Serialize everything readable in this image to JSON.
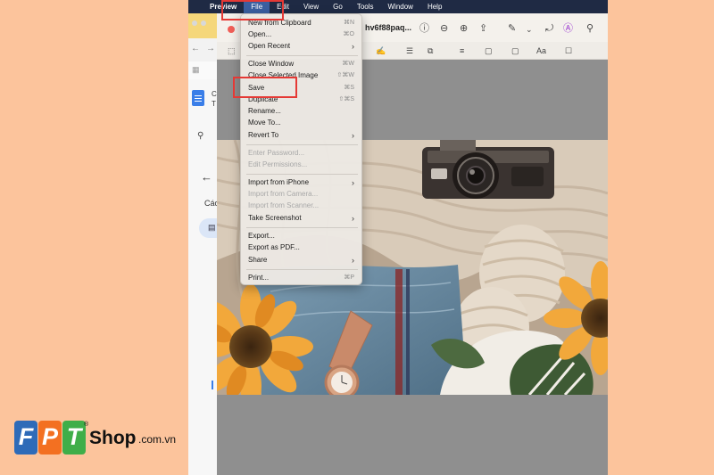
{
  "menubar": {
    "app_name": "Preview",
    "items": [
      "File",
      "Edit",
      "View",
      "Go",
      "Tools",
      "Window",
      "Help"
    ]
  },
  "background_window": {
    "doc_title_short": "C",
    "doc_title_line2": "T",
    "section_text": "Các"
  },
  "preview": {
    "filename": "hv6f88paq..."
  },
  "file_menu": {
    "items": [
      {
        "label": "New from Clipboard",
        "shortcut": "⌘N",
        "enabled": true
      },
      {
        "label": "Open...",
        "shortcut": "⌘O",
        "enabled": true
      },
      {
        "label": "Open Recent",
        "submenu": true,
        "enabled": true
      },
      {
        "label": "Close Window",
        "shortcut": "⌘W",
        "enabled": true
      },
      {
        "label": "Close Selected Image",
        "shortcut": "⇧⌘W",
        "enabled": true
      },
      {
        "label": "Save",
        "shortcut": "⌘S",
        "enabled": true
      },
      {
        "label": "Duplicate",
        "shortcut": "⇧⌘S",
        "enabled": true
      },
      {
        "label": "Rename...",
        "enabled": true
      },
      {
        "label": "Move To...",
        "enabled": true
      },
      {
        "label": "Revert To",
        "submenu": true,
        "enabled": true
      },
      {
        "label": "Enter Password...",
        "enabled": false
      },
      {
        "label": "Edit Permissions...",
        "enabled": false
      },
      {
        "label": "Import from iPhone",
        "submenu": true,
        "enabled": true
      },
      {
        "label": "Import from Camera...",
        "enabled": false
      },
      {
        "label": "Import from Scanner...",
        "enabled": false
      },
      {
        "label": "Take Screenshot",
        "submenu": true,
        "enabled": true
      },
      {
        "label": "Export...",
        "enabled": true
      },
      {
        "label": "Export as PDF...",
        "enabled": true
      },
      {
        "label": "Share",
        "submenu": true,
        "enabled": true
      },
      {
        "label": "Print...",
        "shortcut": "⌘P",
        "enabled": true
      }
    ]
  },
  "logo": {
    "letters": [
      "F",
      "P",
      "T"
    ],
    "brand": "Shop",
    "domain": ".com.vn",
    "registered": "®",
    "colors": {
      "blue": "#2e6bb8",
      "orange": "#f37021",
      "green": "#3fae49"
    }
  },
  "colors": {
    "page_background": "#fcc49c",
    "highlight_red": "#e53935",
    "menubar": "#1f2a44"
  }
}
